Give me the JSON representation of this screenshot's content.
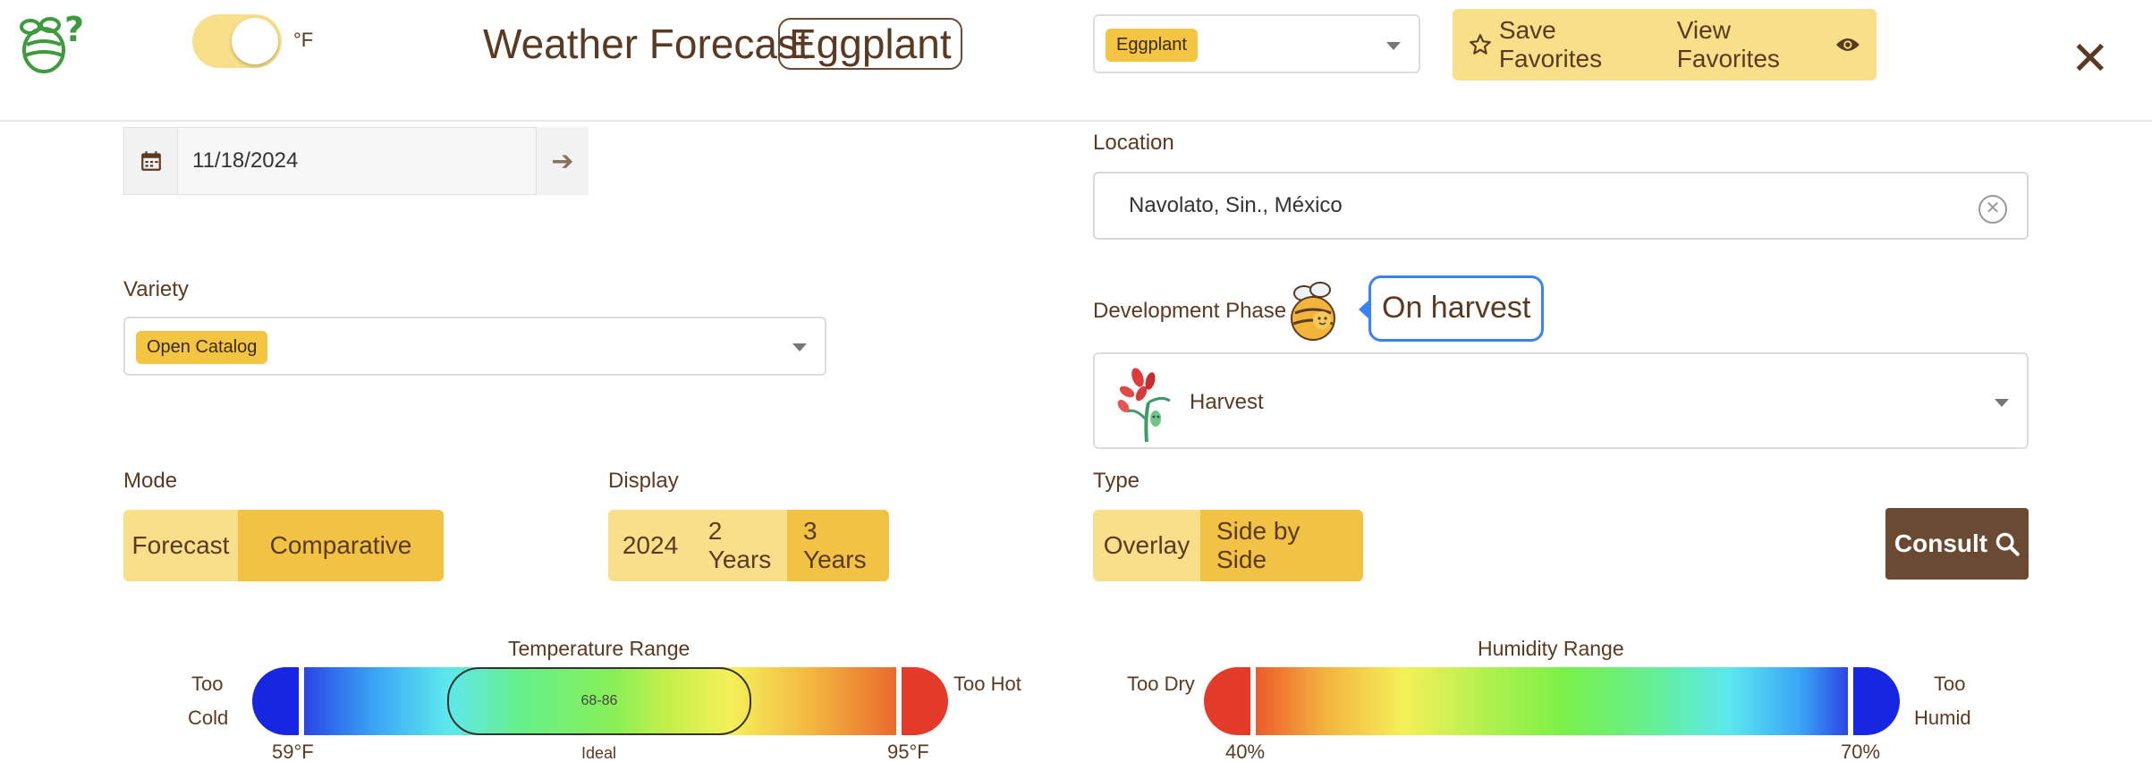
{
  "header": {
    "logo_icon": "bee-question-icon",
    "unit_label": "°F",
    "title": "Weather Forecast",
    "crop_name": "Eggplant",
    "crop_select_value": "Eggplant",
    "save_favorites": "Save Favorites",
    "view_favorites": "View Favorites",
    "close_icon": "close-icon"
  },
  "date": {
    "value": "11/18/2024",
    "calendar_icon": "calendar-icon",
    "arrow_icon": "arrow-right-icon"
  },
  "location": {
    "label": "Location",
    "value": "Navolato, Sin., México"
  },
  "variety": {
    "label": "Variety",
    "value": "Open Catalog"
  },
  "phase": {
    "label": "Development Phase",
    "bubble": "On harvest",
    "value": "Harvest"
  },
  "mode": {
    "label": "Mode",
    "options": [
      "Forecast",
      "Comparative"
    ],
    "active": "Comparative"
  },
  "display": {
    "label": "Display",
    "options": [
      "2024",
      "2 Years",
      "3 Years"
    ],
    "active": "3 Years"
  },
  "type": {
    "label": "Type",
    "options": [
      "Overlay",
      "Side by Side"
    ],
    "active": "Side by Side"
  },
  "consult": {
    "label": "Consult"
  },
  "temperature_range": {
    "title": "Temperature Range",
    "too_low_1": "Too",
    "too_low_2": "Cold",
    "too_high": "Too Hot",
    "min_label": "59°F",
    "max_label": "95°F",
    "ideal_value": "68-86",
    "ideal_label": "Ideal"
  },
  "humidity_range": {
    "title": "Humidity Range",
    "too_low": "Too Dry",
    "too_high_1": "Too",
    "too_high_2": "Humid",
    "min_label": "40%",
    "max_label": "70%"
  },
  "colors": {
    "accent": "#f2c244",
    "accent_light": "#f8e08a",
    "brand_brown": "#6b4a33",
    "bubble_border": "#3b82f6"
  }
}
